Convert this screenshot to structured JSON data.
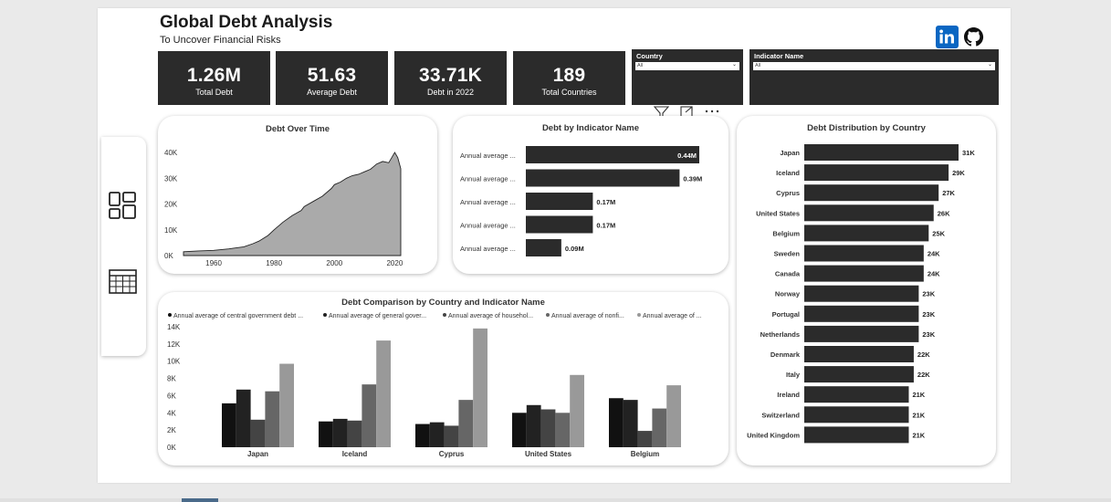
{
  "header": {
    "title": "Global Debt Analysis",
    "subtitle": "To Uncover Financial Risks"
  },
  "kpis": [
    {
      "value": "1.26M",
      "label": "Total Debt"
    },
    {
      "value": "51.63",
      "label": "Average Debt"
    },
    {
      "value": "33.71K",
      "label": "Debt in 2022"
    },
    {
      "value": "189",
      "label": "Total Countries"
    }
  ],
  "slicers": [
    {
      "label": "Country",
      "value": "All"
    },
    {
      "label": "Indicator Name",
      "value": "All"
    }
  ],
  "icons": {
    "nav": [
      "dashboard-icon",
      "table-icon"
    ],
    "social": [
      "linkedin-icon",
      "github-icon"
    ],
    "toolbar": [
      "filter-icon",
      "focus-mode-icon",
      "more-options-icon"
    ]
  },
  "colors": {
    "dark": "#2b2b2b",
    "area": "#aaaaaa",
    "linkedin": "#0a66c2"
  },
  "chart_data": [
    {
      "type": "area",
      "title": "Debt Over Time",
      "x_ticks": [
        "1960",
        "1980",
        "2000",
        "2020"
      ],
      "y_ticks": [
        "0K",
        "10K",
        "20K",
        "30K",
        "40K"
      ],
      "xlim": [
        1950,
        2022
      ],
      "ylim": [
        0,
        40000
      ],
      "x": [
        1950,
        1955,
        1960,
        1965,
        1970,
        1973,
        1975,
        1978,
        1980,
        1983,
        1986,
        1989,
        1990,
        1993,
        1996,
        1999,
        2000,
        2002,
        2004,
        2006,
        2008,
        2010,
        2012,
        2014,
        2016,
        2018,
        2019,
        2020,
        2021,
        2022
      ],
      "values": [
        1500,
        1800,
        2000,
        2600,
        3400,
        4600,
        5600,
        7800,
        10000,
        13000,
        15500,
        17500,
        19000,
        21000,
        23000,
        26000,
        27500,
        28500,
        30000,
        31000,
        31500,
        32500,
        33500,
        35500,
        36500,
        36000,
        38000,
        40000,
        38000,
        33710
      ]
    },
    {
      "type": "bar",
      "orientation": "horizontal",
      "title": "Debt by Indicator Name",
      "categories": [
        "Annual average ...",
        "Annual average ...",
        "Annual average ...",
        "Annual average ...",
        "Annual average ..."
      ],
      "values": [
        0.44,
        0.39,
        0.17,
        0.17,
        0.09
      ],
      "labels": [
        "0.44M",
        "0.39M",
        "0.17M",
        "0.17M",
        "0.09M"
      ],
      "xlim": [
        0,
        0.44
      ]
    },
    {
      "type": "bar",
      "title": "Debt Comparison by Country and Indicator Name",
      "categories": [
        "Japan",
        "Iceland",
        "Cyprus",
        "United States",
        "Belgium"
      ],
      "y_ticks": [
        "0K",
        "2K",
        "4K",
        "6K",
        "8K",
        "10K",
        "12K",
        "14K"
      ],
      "ylim": [
        0,
        14000
      ],
      "legend_position": "top-left",
      "series": [
        {
          "name": "Annual average of central government debt ...",
          "color": "#111111",
          "values": [
            5100,
            3000,
            2700,
            4000,
            5700
          ]
        },
        {
          "name": "Annual average of general gover...",
          "color": "#222222",
          "values": [
            6700,
            3300,
            2900,
            4900,
            5500
          ]
        },
        {
          "name": "Annual average of househol...",
          "color": "#444444",
          "values": [
            3200,
            3100,
            2500,
            4400,
            1900
          ]
        },
        {
          "name": "Annual average of nonfi...",
          "color": "#666666",
          "values": [
            6500,
            7300,
            5500,
            4000,
            4500
          ]
        },
        {
          "name": "Annual average of ...",
          "color": "#999999",
          "values": [
            9700,
            12400,
            13800,
            8400,
            7200
          ]
        }
      ]
    },
    {
      "type": "bar",
      "orientation": "horizontal",
      "title": "Debt Distribution by Country",
      "categories": [
        "Japan",
        "Iceland",
        "Cyprus",
        "United States",
        "Belgium",
        "Sweden",
        "Canada",
        "Norway",
        "Portugal",
        "Netherlands",
        "Denmark",
        "Italy",
        "Ireland",
        "Switzerland",
        "United Kingdom"
      ],
      "values": [
        31,
        29,
        27,
        26,
        25,
        24,
        24,
        23,
        23,
        23,
        22,
        22,
        21,
        21,
        21
      ],
      "labels": [
        "31K",
        "29K",
        "27K",
        "26K",
        "25K",
        "24K",
        "24K",
        "23K",
        "23K",
        "23K",
        "22K",
        "22K",
        "21K",
        "21K",
        "21K"
      ],
      "xlim": [
        0,
        31
      ]
    }
  ]
}
